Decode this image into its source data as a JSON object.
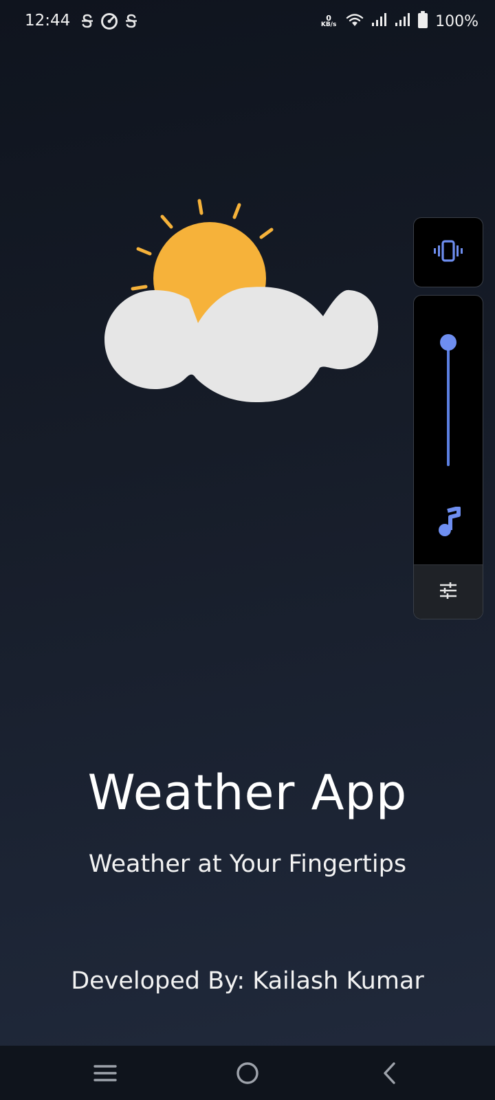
{
  "status_bar": {
    "time": "12:44",
    "notification_icons": [
      "s-icon",
      "speedometer-icon",
      "s-icon"
    ],
    "network_speed_value": "0",
    "network_speed_unit": "KB/s",
    "battery_percent": "100%"
  },
  "main": {
    "illustration": "sun-behind-cloud-icon",
    "title": "Weather App",
    "tagline": "Weather at Your Fingertips",
    "developer": "Developed By: Kailash Kumar"
  },
  "volume_panel": {
    "vibrate_icon": "vibrate-icon",
    "media_volume_level": 1.0,
    "media_icon": "music-note-icon",
    "settings_icon": "tune-icon",
    "accent_color": "#6e8ef0"
  },
  "nav_bar": {
    "buttons": [
      "recents-menu-icon",
      "home-circle-icon",
      "back-chevron-icon"
    ]
  },
  "colors": {
    "sun": "#f6b23a",
    "cloud": "#e6e6e6",
    "background_top": "#0f141e",
    "background_bottom": "#212a3c"
  }
}
